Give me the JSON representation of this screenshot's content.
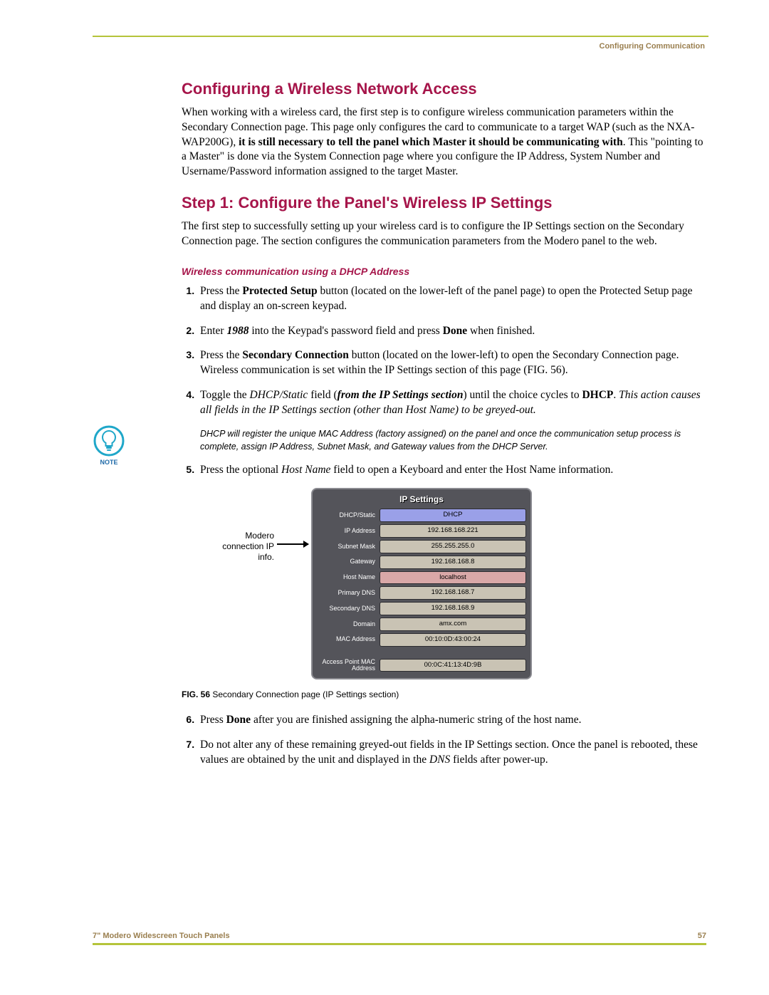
{
  "header": {
    "section": "Configuring Communication"
  },
  "h1": "Configuring a Wireless Network Access",
  "p1a": "When working with a wireless card, the first step is to configure wireless communication parameters within the Secondary Connection page. This page only configures the card to communicate to a target WAP (such as the NXA-WAP200G), ",
  "p1b": "it is still necessary to tell the panel which Master it should be communicating with",
  "p1c": ". This \"pointing to a Master\" is done via the System Connection page where you configure the IP Address, System Number and Username/Password information assigned to the target Master.",
  "h2": "Step 1: Configure the Panel's Wireless IP Settings",
  "p2": "The first step to successfully setting up your wireless card is to configure the IP Settings section on the Secondary Connection page. The section configures the communication parameters from the Modero panel to the web.",
  "h3": "Wireless communication using a DHCP Address",
  "steps": {
    "s1a": "Press the ",
    "s1b": "Protected Setup",
    "s1c": " button (located on the lower-left of the panel page) to open the Protected Setup page and display an on-screen keypad.",
    "s2a": "Enter ",
    "s2b": "1988",
    "s2c": " into the Keypad's password field and press ",
    "s2d": "Done",
    "s2e": " when finished.",
    "s3a": "Press the ",
    "s3b": "Secondary Connection",
    "s3c": " button (located on the lower-left) to open the Secondary Connection page. Wireless communication is set within the IP Settings section of this page (FIG. 56).",
    "s4a": "Toggle the ",
    "s4b": "DHCP/Static",
    "s4c": " field (",
    "s4d": "from the IP Settings section",
    "s4e": ") until the choice cycles to ",
    "s4f": "DHCP",
    "s4g": ". ",
    "s4h": "This action causes all fields in the IP Settings section (other than Host Name) to be greyed-out.",
    "s5a": "Press the optional ",
    "s5b": "Host Name",
    "s5c": " field to open a Keyboard and enter the Host Name information.",
    "s6a": "Press ",
    "s6b": "Done",
    "s6c": " after you are finished assigning the alpha-numeric string of the host name.",
    "s7a": "Do not alter any of these remaining greyed-out fields in the IP Settings section. Once the panel is rebooted, these values are obtained by the unit and displayed in the ",
    "s7b": "DNS",
    "s7c": " fields after power-up."
  },
  "note": {
    "label": "NOTE",
    "text": "DHCP will register the unique MAC Address (factory assigned) on the panel and once the communication setup process is complete, assign IP Address, Subnet Mask, and Gateway values from the DHCP Server."
  },
  "figure": {
    "callout": "Modero connection IP info.",
    "title": "IP Settings",
    "rows": {
      "dhcp_k": "DHCP/Static",
      "dhcp_v": "DHCP",
      "ip_k": "IP Address",
      "ip_v": "192.168.168.221",
      "sm_k": "Subnet Mask",
      "sm_v": "255.255.255.0",
      "gw_k": "Gateway",
      "gw_v": "192.168.168.8",
      "hn_k": "Host Name",
      "hn_v": "localhost",
      "pd_k": "Primary DNS",
      "pd_v": "192.168.168.7",
      "sd_k": "Secondary DNS",
      "sd_v": "192.168.168.9",
      "dm_k": "Domain",
      "dm_v": "amx.com",
      "mac_k": "MAC Address",
      "mac_v": "00:10:0D:43:00:24",
      "ap_k": "Access Point MAC Address",
      "ap_v": "00:0C:41:13:4D:9B"
    },
    "caption_b": "FIG. 56",
    "caption_t": "  Secondary Connection page (IP Settings section)"
  },
  "footer": {
    "left": "7\" Modero Widescreen Touch Panels",
    "right": "57"
  }
}
